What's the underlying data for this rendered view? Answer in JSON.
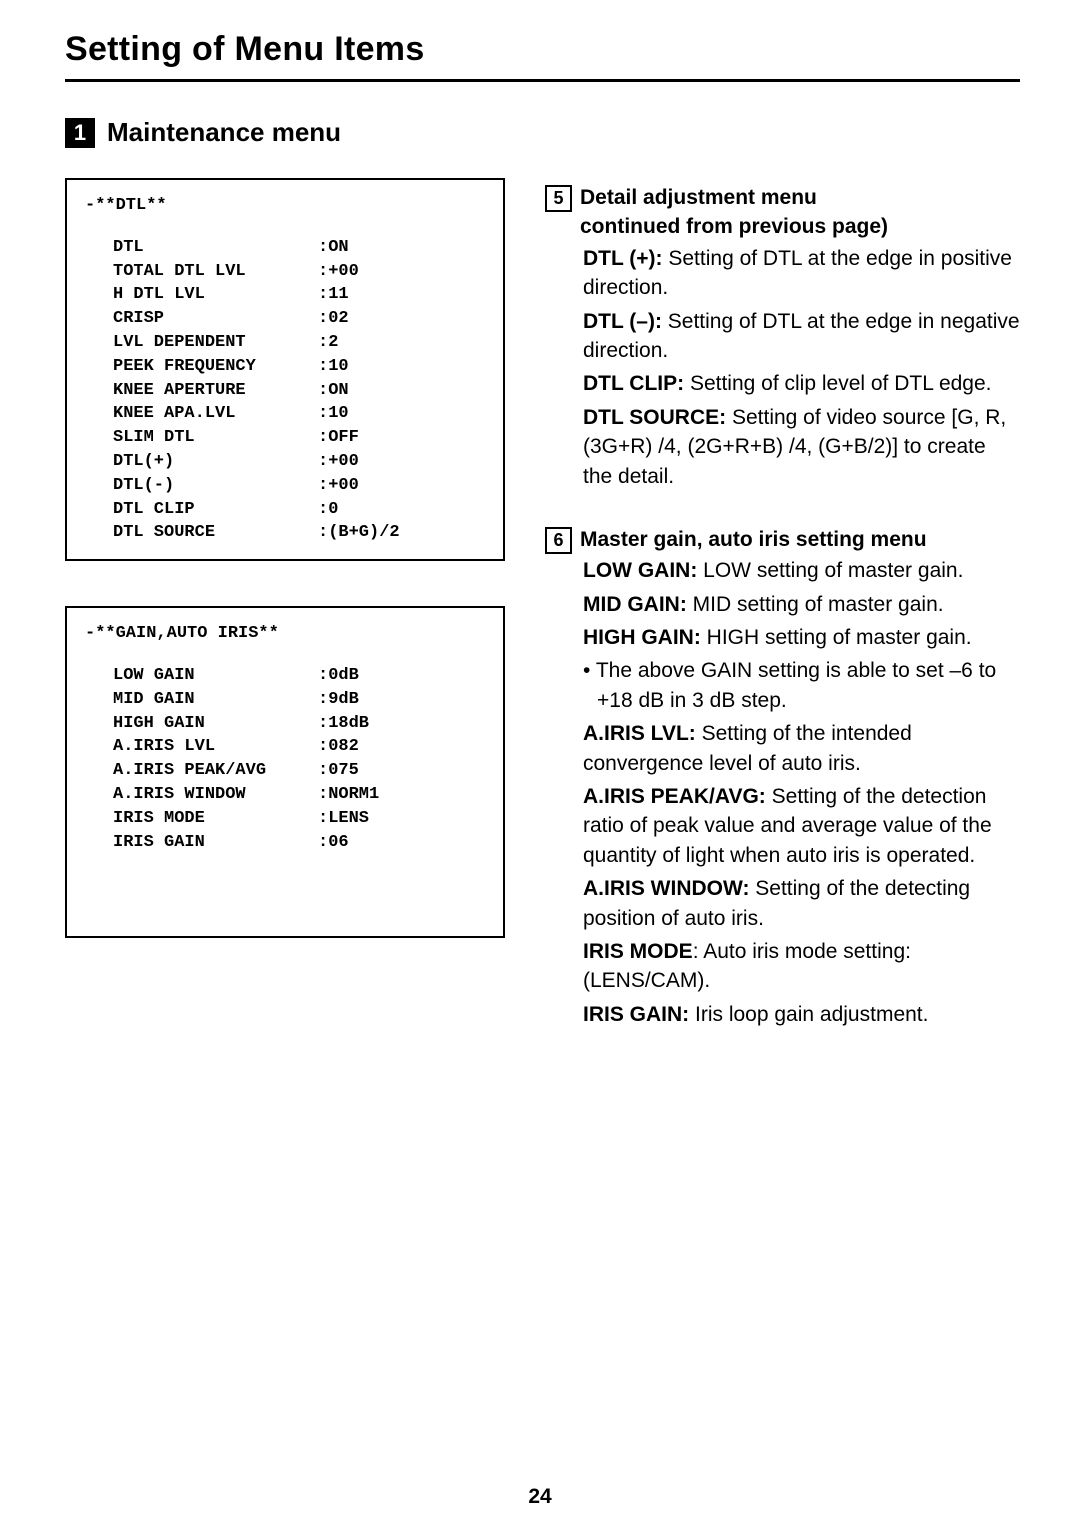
{
  "page_title": "Setting of Menu Items",
  "section": {
    "number": "1",
    "title": "Maintenance menu"
  },
  "menu1": {
    "header": "-**DTL**",
    "rows": [
      {
        "k": "DTL",
        "v": ":ON"
      },
      {
        "k": "TOTAL DTL LVL",
        "v": ":+00"
      },
      {
        "k": "H DTL LVL",
        "v": ":11"
      },
      {
        "k": "CRISP",
        "v": ":02"
      },
      {
        "k": "LVL DEPENDENT",
        "v": ":2"
      },
      {
        "k": "PEEK FREQUENCY",
        "v": ":10"
      },
      {
        "k": "KNEE APERTURE",
        "v": ":ON"
      },
      {
        "k": "KNEE APA.LVL",
        "v": ":10"
      },
      {
        "k": "SLIM DTL",
        "v": ":OFF"
      },
      {
        "k": "DTL(+)",
        "v": ":+00"
      },
      {
        "k": "DTL(-)",
        "v": ":+00"
      },
      {
        "k": "DTL CLIP",
        "v": ":0"
      },
      {
        "k": "DTL SOURCE",
        "v": ":(B+G)/2"
      }
    ]
  },
  "menu2": {
    "header": "-**GAIN,AUTO IRIS**",
    "rows": [
      {
        "k": "LOW GAIN",
        "v": ":0dB"
      },
      {
        "k": "MID GAIN",
        "v": ":9dB"
      },
      {
        "k": "HIGH GAIN",
        "v": ":18dB"
      },
      {
        "k": "A.IRIS LVL",
        "v": ":082"
      },
      {
        "k": "A.IRIS PEAK/AVG",
        "v": ":075"
      },
      {
        "k": "A.IRIS WINDOW",
        "v": ":NORM1"
      },
      {
        "k": "IRIS MODE",
        "v": ":LENS"
      },
      {
        "k": "IRIS GAIN",
        "v": ":06"
      }
    ]
  },
  "desc5": {
    "num": "5",
    "title_line1": "Detail adjustment menu",
    "title_line2": "continued from previous page)",
    "items": [
      {
        "lbl": "DTL (+):",
        "txt": " Setting of DTL at the edge in positive direction."
      },
      {
        "lbl": "DTL (–):",
        "txt": " Setting of DTL at the edge in negative direction."
      },
      {
        "lbl": "DTL CLIP:",
        "txt": " Setting of clip level of DTL edge."
      },
      {
        "lbl": "DTL SOURCE:",
        "txt": " Setting of video source [G, R, (3G+R) /4, (2G+R+B) /4, (G+B/2)] to create the detail."
      }
    ]
  },
  "desc6": {
    "num": "6",
    "title": "Master gain, auto iris setting menu",
    "items_a": [
      {
        "lbl": "LOW GAIN:",
        "txt": " LOW setting of master gain."
      },
      {
        "lbl": "MID GAIN:",
        "txt": " MID setting of master gain."
      },
      {
        "lbl": "HIGH GAIN:",
        "txt": " HIGH setting of master gain."
      }
    ],
    "bullet": "The above GAIN setting is able to set –6 to +18 dB in 3 dB step.",
    "items_b": [
      {
        "lbl": "A.IRIS LVL:",
        "txt": " Setting of the intended convergence level of auto iris."
      },
      {
        "lbl": "A.IRIS PEAK/AVG:",
        "txt": " Setting of the detection ratio of peak value and average value of the quantity of light when auto iris is operated."
      },
      {
        "lbl": "A.IRIS WINDOW:",
        "txt": " Setting of the detecting position of auto iris."
      },
      {
        "lbl": "IRIS MODE",
        "txt": ": Auto iris mode setting: (LENS/CAM)."
      },
      {
        "lbl": "IRIS GAIN:",
        "txt": " Iris loop gain adjustment."
      }
    ]
  },
  "page_number": "24"
}
